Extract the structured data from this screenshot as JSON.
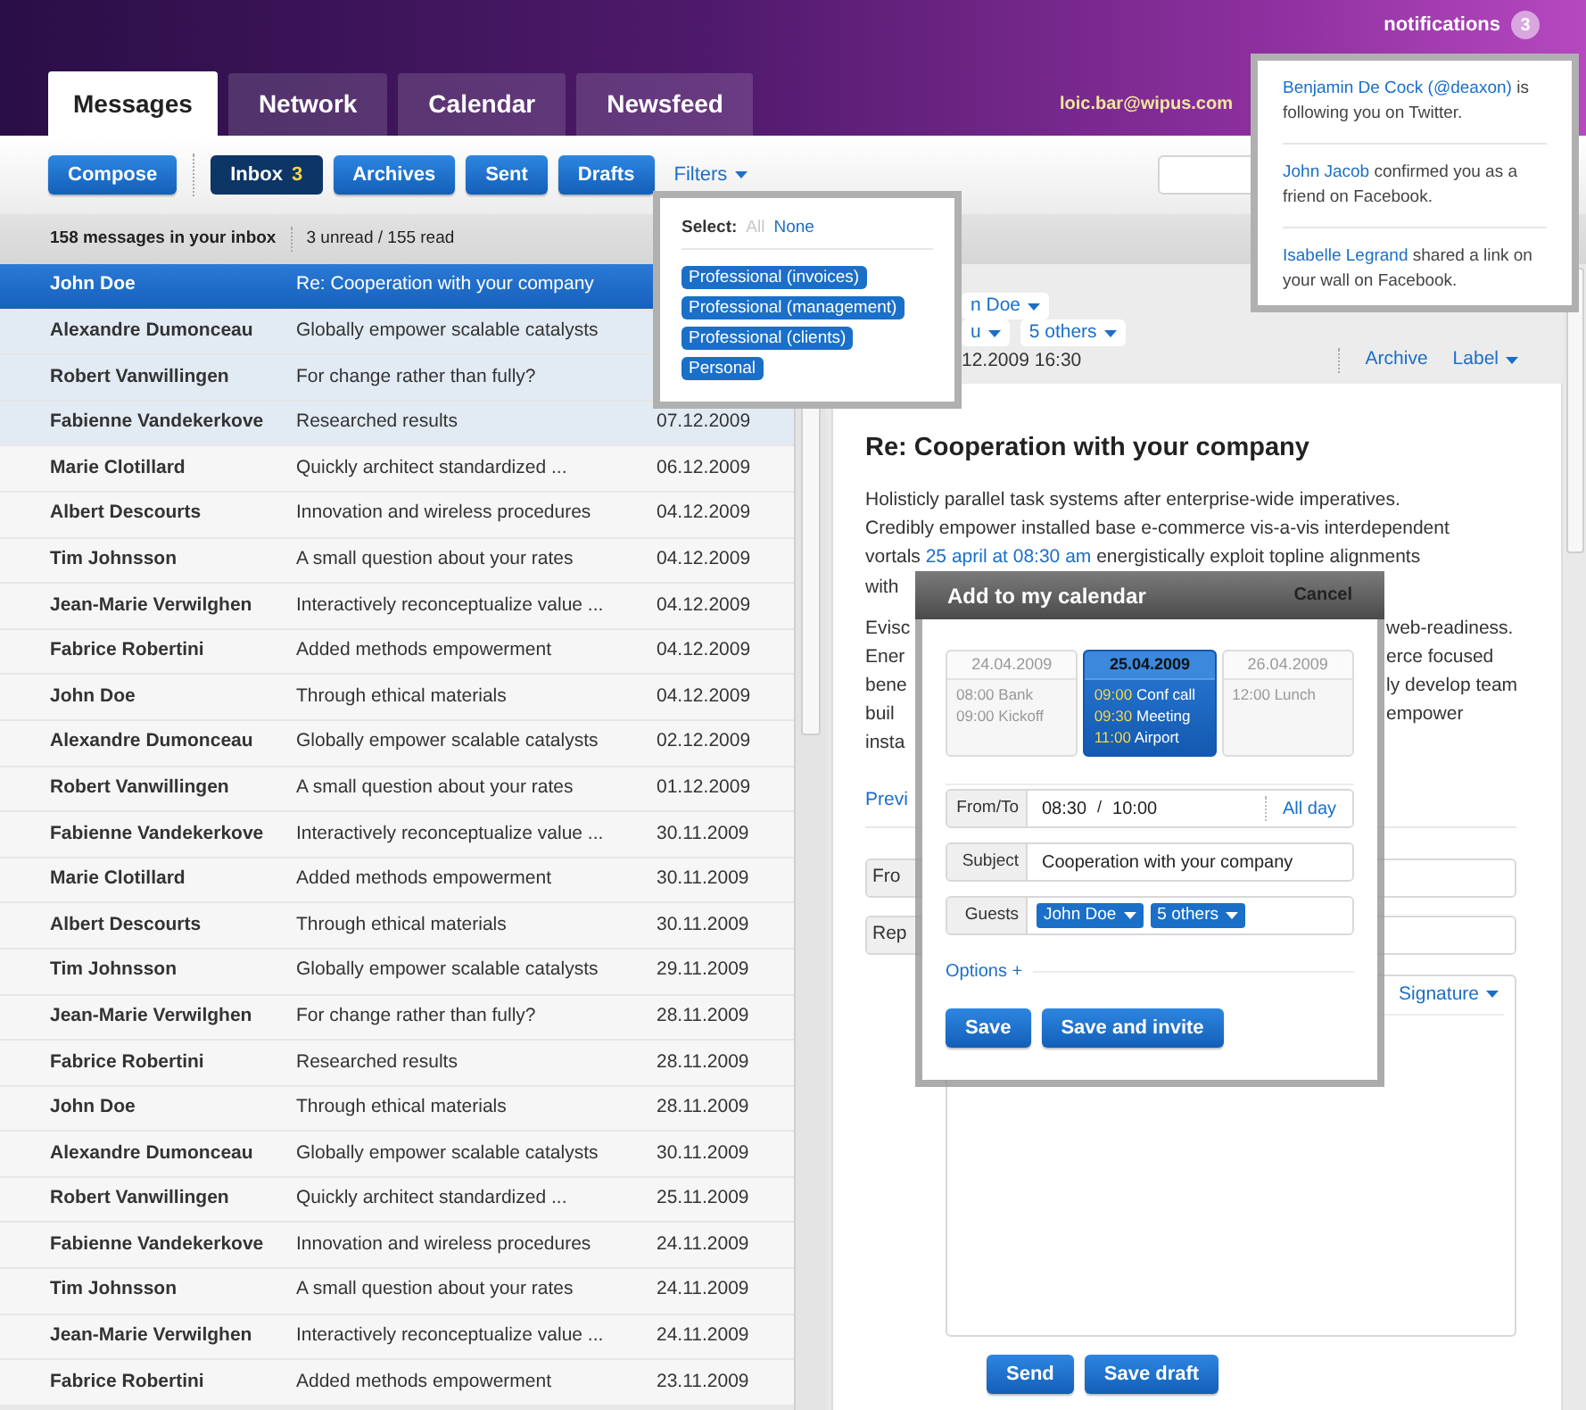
{
  "header": {
    "tabs": [
      {
        "label": "Messages",
        "selected": true
      },
      {
        "label": "Network",
        "selected": false
      },
      {
        "label": "Calendar",
        "selected": false
      },
      {
        "label": "Newsfeed",
        "selected": false
      }
    ],
    "user_email": "loic.bar@wipus.com",
    "notifications": {
      "label": "notifications",
      "count": "3"
    }
  },
  "toolbar": {
    "compose": "Compose",
    "folders": [
      {
        "label": "Inbox",
        "count": "3",
        "selected": true
      },
      {
        "label": "Archives",
        "selected": false
      },
      {
        "label": "Sent",
        "selected": false
      },
      {
        "label": "Drafts",
        "selected": false
      }
    ],
    "filters": "Filters"
  },
  "summary": {
    "total": "158 messages in your inbox",
    "status": "3 unread / 155 read"
  },
  "messages": [
    {
      "sender": "John Doe",
      "subject": "Re: Cooperation with your company",
      "selected": true,
      "unread": false
    },
    {
      "sender": "Alexandre Dumonceau",
      "subject": "Globally empower scalable catalysts",
      "selected": false,
      "unread": true
    },
    {
      "sender": "Robert Vanwillingen",
      "subject": "For change rather than fully?",
      "selected": false,
      "unread": true
    },
    {
      "sender": "Fabienne Vandekerkove",
      "subject": "Researched results",
      "date": "07.12.2009",
      "selected": false,
      "unread": true
    },
    {
      "sender": "Marie Clotillard",
      "subject": "Quickly architect standardized ...",
      "date": "06.12.2009",
      "selected": false,
      "unread": false
    },
    {
      "sender": "Albert Descourts",
      "subject": "Innovation and wireless procedures",
      "date": "04.12.2009",
      "selected": false,
      "unread": false
    },
    {
      "sender": "Tim Johnsson",
      "subject": "A small question about your rates",
      "date": "04.12.2009",
      "selected": false,
      "unread": false
    },
    {
      "sender": "Jean-Marie Verwilghen",
      "subject": "Interactively reconceptualize value ...",
      "date": "04.12.2009",
      "selected": false,
      "unread": false
    },
    {
      "sender": "Fabrice Robertini",
      "subject": "Added methods empowerment",
      "date": "04.12.2009",
      "selected": false,
      "unread": false
    },
    {
      "sender": "John Doe",
      "subject": "Through ethical materials",
      "date": "04.12.2009",
      "selected": false,
      "unread": false
    },
    {
      "sender": "Alexandre Dumonceau",
      "subject": "Globally empower scalable catalysts",
      "date": "02.12.2009",
      "selected": false,
      "unread": false
    },
    {
      "sender": "Robert Vanwillingen",
      "subject": "A small question about your rates",
      "date": "01.12.2009",
      "selected": false,
      "unread": false
    },
    {
      "sender": "Fabienne Vandekerkove",
      "subject": "Interactively reconceptualize value ...",
      "date": "30.11.2009",
      "selected": false,
      "unread": false
    },
    {
      "sender": "Marie Clotillard",
      "subject": "Added methods empowerment",
      "date": "30.11.2009",
      "selected": false,
      "unread": false
    },
    {
      "sender": "Albert Descourts",
      "subject": "Through ethical materials",
      "date": "30.11.2009",
      "selected": false,
      "unread": false
    },
    {
      "sender": "Tim Johnsson",
      "subject": "Globally empower scalable catalysts",
      "date": "29.11.2009",
      "selected": false,
      "unread": false
    },
    {
      "sender": "Jean-Marie Verwilghen",
      "subject": "For change rather than fully?",
      "date": "28.11.2009",
      "selected": false,
      "unread": false
    },
    {
      "sender": "Fabrice Robertini",
      "subject": "Researched results",
      "date": "28.11.2009",
      "selected": false,
      "unread": false
    },
    {
      "sender": "John Doe",
      "subject": "Through ethical materials",
      "date": "28.11.2009",
      "selected": false,
      "unread": false
    },
    {
      "sender": "Alexandre Dumonceau",
      "subject": "Globally empower scalable catalysts",
      "date": "30.11.2009",
      "selected": false,
      "unread": false
    },
    {
      "sender": "Robert Vanwillingen",
      "subject": "Quickly architect standardized ...",
      "date": "25.11.2009",
      "selected": false,
      "unread": false
    },
    {
      "sender": "Fabienne Vandekerkove",
      "subject": "Innovation and wireless procedures",
      "date": "24.11.2009",
      "selected": false,
      "unread": false
    },
    {
      "sender": "Tim Johnsson",
      "subject": "A small question about your rates",
      "date": "24.11.2009",
      "selected": false,
      "unread": false
    },
    {
      "sender": "Jean-Marie Verwilghen",
      "subject": "Interactively reconceptualize value ...",
      "date": "24.11.2009",
      "selected": false,
      "unread": false
    },
    {
      "sender": "Fabrice Robertini",
      "subject": "Added methods empowerment",
      "date": "23.11.2009",
      "selected": false,
      "unread": false
    }
  ],
  "message_view": {
    "from_chip": "n Doe",
    "to_chips": [
      "u",
      "5 others"
    ],
    "date": "12.2009 16:30",
    "actions": [
      {
        "label": "Archive",
        "dropdown": false
      },
      {
        "label": "Label",
        "dropdown": true
      }
    ],
    "subject": "Re: Cooperation with your company",
    "paragraph_1": [
      [
        {
          "text": "Holisticly parallel task systems after enterprise-wide imperatives."
        }
      ],
      [
        {
          "text": "Credibly empower installed base e-commerce vis-a-vis interdependent"
        }
      ],
      [
        {
          "text": "vortals "
        },
        {
          "text": "25 april at 08:30 am",
          "link": true
        },
        {
          "text": " energistically exploit topline alignments"
        }
      ],
      [
        {
          "text": "with"
        }
      ]
    ],
    "paragraph_2": {
      "left_lines": [
        "Evisc",
        "Ener",
        "bene",
        "buil",
        "insta"
      ],
      "right_lines": [
        "web-readiness.",
        "erce focused",
        "ly develop team",
        "empower"
      ]
    }
  },
  "reply": {
    "preview_link": "Previ",
    "fields": [
      "Fro",
      "Rep"
    ],
    "signature": "Signature",
    "buttons": [
      "Send",
      "Save draft"
    ]
  },
  "filters_menu": {
    "select_label": "Select:",
    "options": [
      {
        "label": "All",
        "disabled": true
      },
      {
        "label": "None",
        "disabled": false
      }
    ],
    "labels": [
      "Professional (invoices)",
      "Professional (management)",
      "Professional (clients)",
      "Personal"
    ]
  },
  "notification_popup": [
    {
      "link": "Benjamin De Cock (@deaxon)",
      "text": "is following you on Twitter."
    },
    {
      "link": "John Jacob",
      "text": "confirmed you as a friend on Facebook."
    },
    {
      "link": "Isabelle Legrand",
      "text": "shared a link on your wall on Facebook."
    }
  ],
  "calendar_dialog": {
    "title": "Add to my calendar",
    "cancel": "Cancel",
    "days": [
      {
        "date": "24.04.2009",
        "selected": false,
        "events": [
          {
            "time": "08:00",
            "title": "Bank"
          },
          {
            "time": "09:00",
            "title": "Kickoff"
          }
        ]
      },
      {
        "date": "25.04.2009",
        "selected": true,
        "events": [
          {
            "time": "09:00",
            "title": "Conf call"
          },
          {
            "time": "09:30",
            "title": "Meeting"
          },
          {
            "time": "11:00",
            "title": "Airport"
          }
        ]
      },
      {
        "date": "26.04.2009",
        "selected": false,
        "events": [
          {
            "time": "12:00",
            "title": "Lunch"
          }
        ]
      }
    ],
    "from_to": {
      "label": "From/To",
      "from": "08:30",
      "separator": "/",
      "to": "10:00",
      "all_day": "All day"
    },
    "subject": {
      "label": "Subject",
      "value": "Cooperation with your company"
    },
    "guests": {
      "label": "Guests",
      "chips": [
        "John Doe",
        "5 others"
      ]
    },
    "options": "Options +",
    "buttons": [
      "Save",
      "Save and invite"
    ]
  }
}
